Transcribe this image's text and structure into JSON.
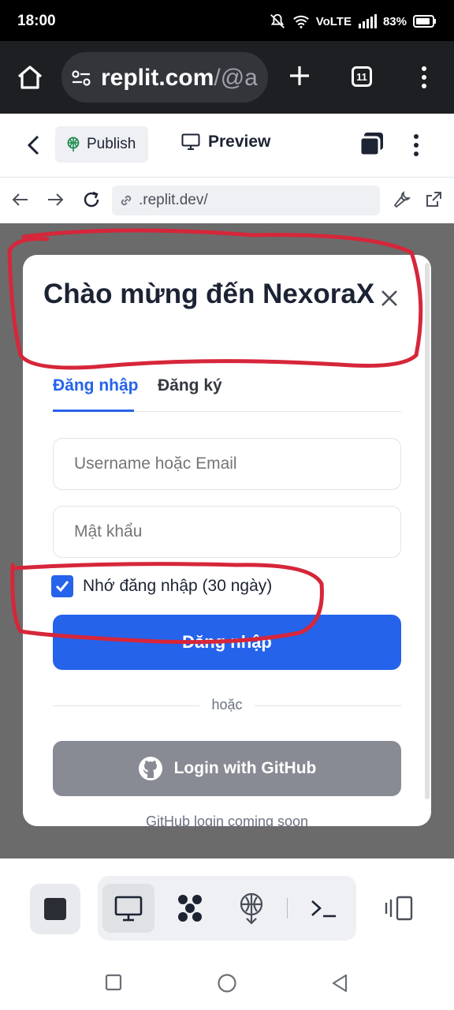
{
  "status_bar": {
    "time": "18:00",
    "network": "VoLTE",
    "battery": "83%"
  },
  "browser": {
    "url_domain": "replit.com",
    "url_path": "/@a",
    "tab_count": "11"
  },
  "replit_toolbar": {
    "publish_label": "Publish",
    "preview_label": "Preview"
  },
  "inner_url": ".replit.dev/",
  "modal": {
    "title": "Chào mừng đến NexoraX",
    "tabs": [
      {
        "label": "Đăng nhập",
        "active": true
      },
      {
        "label": "Đăng ký",
        "active": false
      }
    ],
    "username_placeholder": "Username hoặc Email",
    "password_placeholder": "Mật khẩu",
    "remember_label": "Nhớ đăng nhập (30 ngày)",
    "remember_checked": true,
    "login_button": "Đăng nhập",
    "divider_text": "hoặc",
    "github_button": "Login with GitHub",
    "github_note": "GitHub login coming soon"
  },
  "colors": {
    "accent": "#2563eb",
    "annotation": "#d6263a"
  },
  "icons": {
    "bottom_tools": [
      "monitor-icon",
      "workspace-icon",
      "deploy-icon",
      "shell-icon"
    ]
  }
}
